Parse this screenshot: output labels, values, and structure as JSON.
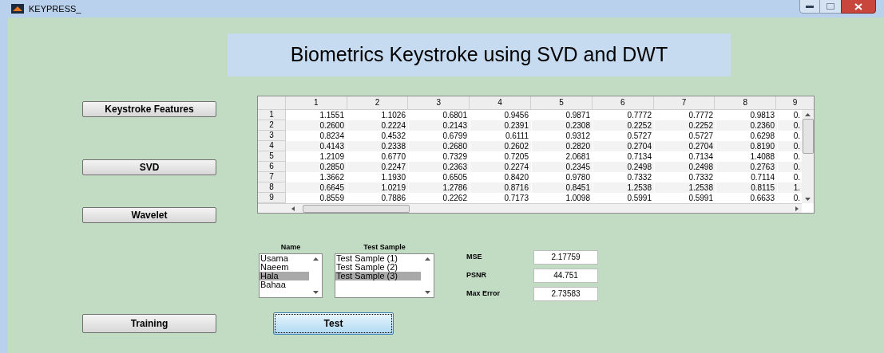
{
  "window": {
    "title": "KEYPRESS_"
  },
  "banner": "Biometrics Keystroke using SVD and DWT",
  "side_buttons": [
    "Keystroke Features",
    "SVD",
    "Wavelet",
    "Training"
  ],
  "table": {
    "columns": [
      "1",
      "2",
      "3",
      "4",
      "5",
      "6",
      "7",
      "8",
      "9"
    ],
    "rows": [
      {
        "header": "1",
        "cells": [
          "1.1551",
          "1.1026",
          "0.6801",
          "0.9456",
          "0.9871",
          "0.7772",
          "0.7772",
          "0.9813",
          "0."
        ]
      },
      {
        "header": "2",
        "cells": [
          "0.2600",
          "0.2224",
          "0.2143",
          "0.2391",
          "0.2308",
          "0.2252",
          "0.2252",
          "0.2360",
          "0."
        ]
      },
      {
        "header": "3",
        "cells": [
          "0.8234",
          "0.4532",
          "0.6799",
          "0.6111",
          "0.9312",
          "0.5727",
          "0.5727",
          "0.6298",
          "0."
        ]
      },
      {
        "header": "4",
        "cells": [
          "0.4143",
          "0.2338",
          "0.2680",
          "0.2602",
          "0.2820",
          "0.2704",
          "0.2704",
          "0.8190",
          "0."
        ]
      },
      {
        "header": "5",
        "cells": [
          "1.2109",
          "0.6770",
          "0.7329",
          "0.7205",
          "2.0681",
          "0.7134",
          "0.7134",
          "1.4088",
          "0."
        ]
      },
      {
        "header": "6",
        "cells": [
          "0.2850",
          "0.2247",
          "0.2363",
          "0.2274",
          "0.2345",
          "0.2498",
          "0.2498",
          "0.2763",
          "0."
        ]
      },
      {
        "header": "7",
        "cells": [
          "1.3662",
          "1.1930",
          "0.6505",
          "0.8420",
          "0.9780",
          "0.7332",
          "0.7332",
          "0.7114",
          "0."
        ]
      },
      {
        "header": "8",
        "cells": [
          "0.6645",
          "1.0219",
          "1.2786",
          "0.8716",
          "0.8451",
          "1.2538",
          "1.2538",
          "0.8115",
          "1."
        ]
      },
      {
        "header": "9",
        "cells": [
          "0.8559",
          "0.7886",
          "0.2262",
          "0.7173",
          "1.0098",
          "0.5991",
          "0.5991",
          "0.6633",
          "0."
        ]
      }
    ]
  },
  "lists": [
    {
      "label": "Name",
      "items": [
        {
          "text": "Usama",
          "selected": false
        },
        {
          "text": "Naeem",
          "selected": false
        },
        {
          "text": "Hala",
          "selected": true
        },
        {
          "text": "Bahaa",
          "selected": false
        }
      ]
    },
    {
      "label": "Test Sample",
      "items": [
        {
          "text": "Test Sample (1)",
          "selected": false
        },
        {
          "text": "Test Sample (2)",
          "selected": false
        },
        {
          "text": "Test Sample (3)",
          "selected": true
        }
      ]
    }
  ],
  "metrics": [
    {
      "label": "MSE",
      "value": "2.17759"
    },
    {
      "label": "PSNR",
      "value": "44.751"
    },
    {
      "label": "Max Error",
      "value": "2.73583"
    }
  ],
  "test_button": "Test"
}
